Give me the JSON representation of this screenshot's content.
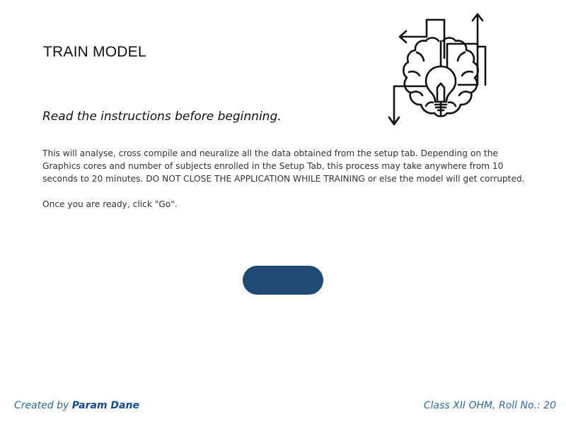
{
  "header": {
    "title": "TRAIN MODEL",
    "logo_icon": "brain-lightbulb-icon"
  },
  "instructions": {
    "heading": "Read the instructions before beginning.",
    "description": "This will analyse, cross compile and neuralize all the data obtained from the setup tab. Depending on the Graphics cores and number of subjects enrolled in the Setup Tab, this process may take anywhere from 10 seconds to 20 minutes. DO NOT CLOSE THE APPLICATION WHILE TRAINING or else the model will get corrupted.",
    "ready": "Once you are ready, click \"Go\"."
  },
  "actions": {
    "go_label": ""
  },
  "footer": {
    "created_prefix": "Created by ",
    "author": "Param Dane",
    "class_info": "Class XII OHM, Roll No.: 20"
  },
  "colors": {
    "button": "#1f4a73",
    "footer_text": "#2c6aab",
    "author_text": "#144a8e"
  }
}
